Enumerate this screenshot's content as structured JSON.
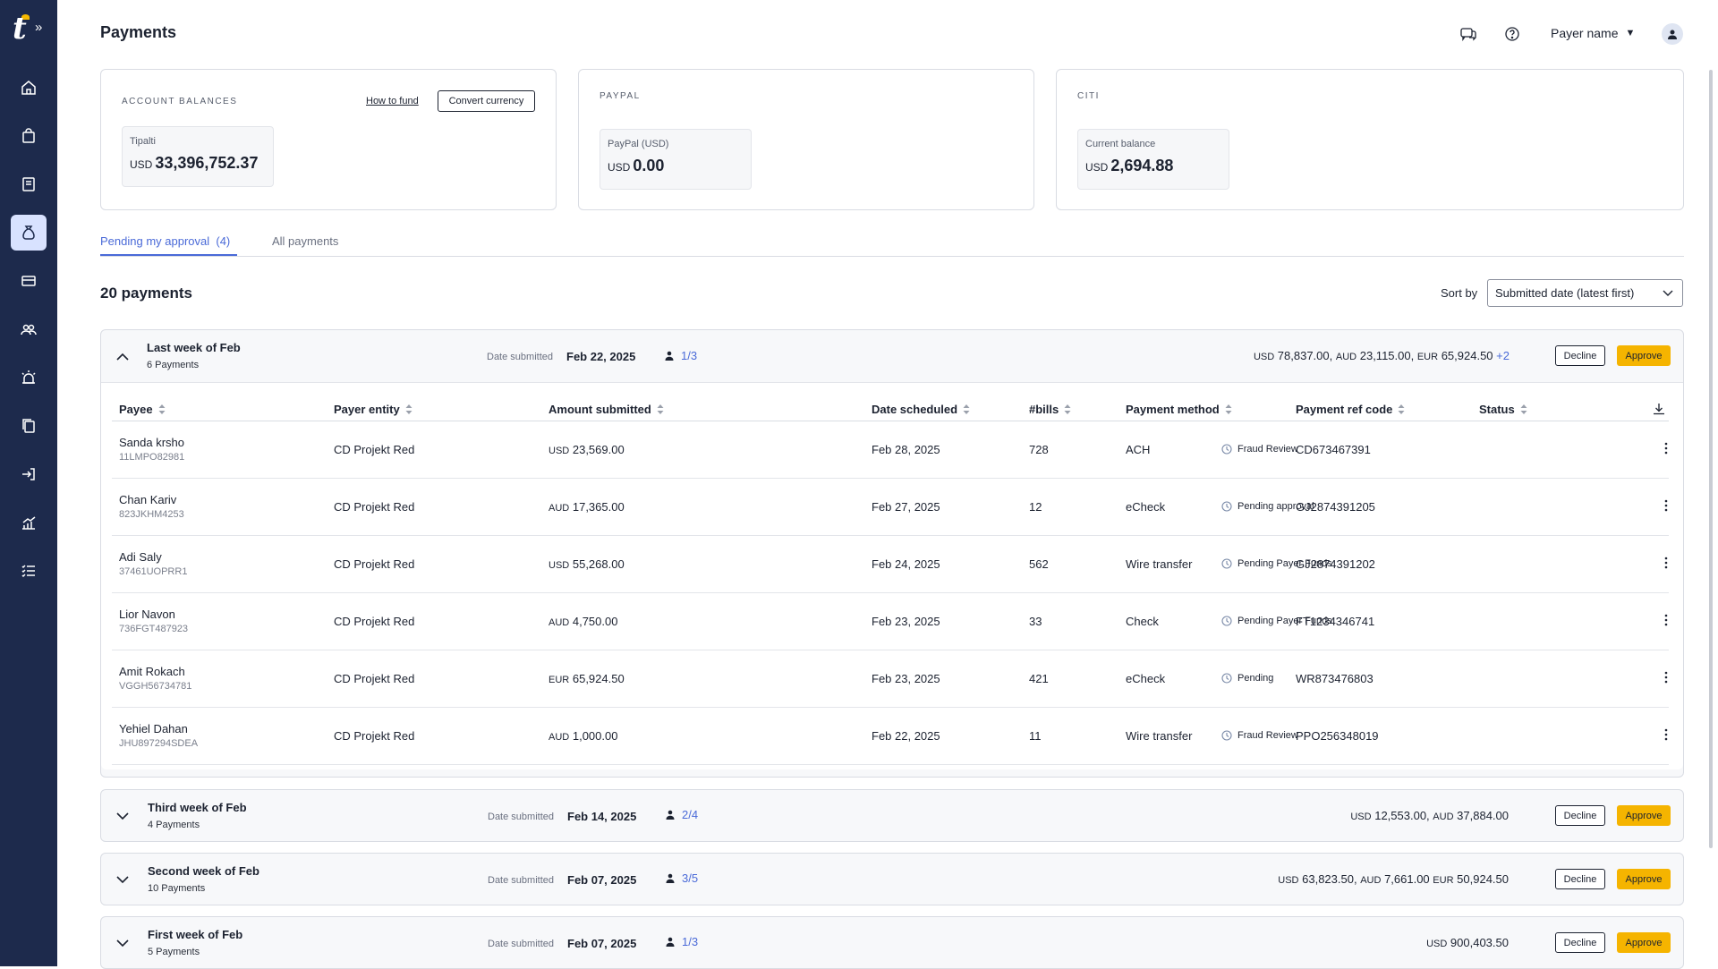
{
  "header": {
    "title": "Payments",
    "payer_name": "Payer name"
  },
  "sidebar": {
    "items": [
      {
        "name": "home-icon",
        "active": false
      },
      {
        "name": "bag-icon",
        "active": false
      },
      {
        "name": "bills-icon",
        "active": false
      },
      {
        "name": "money-bag-icon",
        "active": true
      },
      {
        "name": "card-icon",
        "active": false
      },
      {
        "name": "users-icon",
        "active": false
      },
      {
        "name": "alert-icon",
        "active": false
      },
      {
        "name": "documents-icon",
        "active": false
      },
      {
        "name": "login-icon",
        "active": false
      },
      {
        "name": "analytics-icon",
        "active": false
      },
      {
        "name": "tasks-icon",
        "active": false
      }
    ]
  },
  "cards": {
    "account": {
      "title": "ACCOUNT BALANCES",
      "how_to_fund": "How to fund",
      "convert": "Convert currency",
      "label": "Tipalti",
      "currency": "USD",
      "amount": "33,396,752.37"
    },
    "paypal": {
      "title": "PAYPAL",
      "label": "PayPal (USD)",
      "currency": "USD",
      "amount": "0.00"
    },
    "citi": {
      "title": "CITI",
      "label": "Current balance",
      "currency": "USD",
      "amount": "2,694.88"
    }
  },
  "tabs": {
    "pending": "Pending my approval",
    "pending_count": "(4)",
    "all": "All payments"
  },
  "list": {
    "count": "20 payments",
    "sort_label": "Sort by",
    "sort_value": "Submitted date (latest first)"
  },
  "columns": {
    "payee": "Payee",
    "payer_entity": "Payer entity",
    "amount": "Amount submitted",
    "date": "Date scheduled",
    "bills": "#bills",
    "method": "Payment method",
    "ref": "Payment ref code",
    "status": "Status"
  },
  "buttons": {
    "decline": "Decline",
    "approve": "Approve"
  },
  "groups": [
    {
      "title": "Last week of Feb",
      "sub": "6 Payments",
      "date_label": "Date submitted",
      "date": "Feb 22, 2025",
      "approvals": "1/3",
      "amounts": [
        {
          "cur": "USD",
          "val": "78,837.00,"
        },
        {
          "cur": "AUD",
          "val": "23,115.00,"
        },
        {
          "cur": "EUR",
          "val": "65,924.50"
        }
      ],
      "more": "+2",
      "expanded": true
    },
    {
      "title": "Third week of Feb",
      "sub": "4 Payments",
      "date_label": "Date submitted",
      "date": "Feb 14, 2025",
      "approvals": "2/4",
      "amounts": [
        {
          "cur": "USD",
          "val": "12,553.00,"
        },
        {
          "cur": "AUD",
          "val": "37,884.00"
        }
      ]
    },
    {
      "title": "Second week of Feb",
      "sub": "10 Payments",
      "date_label": "Date submitted",
      "date": "Feb 07, 2025",
      "approvals": "3/5",
      "amounts": [
        {
          "cur": "USD",
          "val": "63,823.50,"
        },
        {
          "cur": "AUD",
          "val": "7,661.00"
        },
        {
          "cur": "EUR",
          "val": "50,924.50"
        }
      ]
    },
    {
      "title": "First week of Feb",
      "sub": "5 Payments",
      "date_label": "Date submitted",
      "date": "Feb 07, 2025",
      "approvals": "1/3",
      "amounts": [
        {
          "cur": "USD",
          "val": "900,403.50"
        }
      ]
    }
  ],
  "rows": [
    {
      "name": "Sanda krsho",
      "id": "11LMPO82981",
      "entity": "CD Projekt Red",
      "cur": "USD",
      "amount": "23,569.00",
      "date": "Feb 28, 2025",
      "bills": "728",
      "method": "ACH",
      "ref": "CD673467391",
      "status": "Fraud Review"
    },
    {
      "name": "Chan Kariv",
      "id": "823JKHM4253",
      "entity": "CD Projekt Red",
      "cur": "AUD",
      "amount": "17,365.00",
      "date": "Feb 27, 2025",
      "bills": "12",
      "method": "eCheck",
      "ref": "GJ2874391205",
      "status": "Pending approval"
    },
    {
      "name": "Adi Saly",
      "id": "37461UOPRR1",
      "entity": "CD Projekt Red",
      "cur": "USD",
      "amount": "55,268.00",
      "date": "Feb 24, 2025",
      "bills": "562",
      "method": "Wire transfer",
      "ref": "GJ2874391202",
      "status": "Pending Payer Funds"
    },
    {
      "name": "Lior Navon",
      "id": "736FGT487923",
      "entity": "CD Projekt Red",
      "cur": "AUD",
      "amount": "4,750.00",
      "date": "Feb 23, 2025",
      "bills": "33",
      "method": "Check",
      "ref": "FT1234346741",
      "status": "Pending Payer Funds"
    },
    {
      "name": "Amit Rokach",
      "id": "VGGH56734781",
      "entity": "CD Projekt Red",
      "cur": "EUR",
      "amount": "65,924.50",
      "date": "Feb 23, 2025",
      "bills": "421",
      "method": "eCheck",
      "ref": "WR873476803",
      "status": "Pending"
    },
    {
      "name": "Yehiel Dahan",
      "id": "JHU897294SDEA",
      "entity": "CD Projekt Red",
      "cur": "AUD",
      "amount": "1,000.00",
      "date": "Feb 22, 2025",
      "bills": "11",
      "method": "Wire transfer",
      "ref": "PPO256348019",
      "status": "Fraud Review"
    }
  ],
  "colors": {
    "sidebar": "#1d2a4c",
    "accent": "#4a6ad8",
    "approve": "#f5b400",
    "active_nav": "#d8e2ff"
  }
}
